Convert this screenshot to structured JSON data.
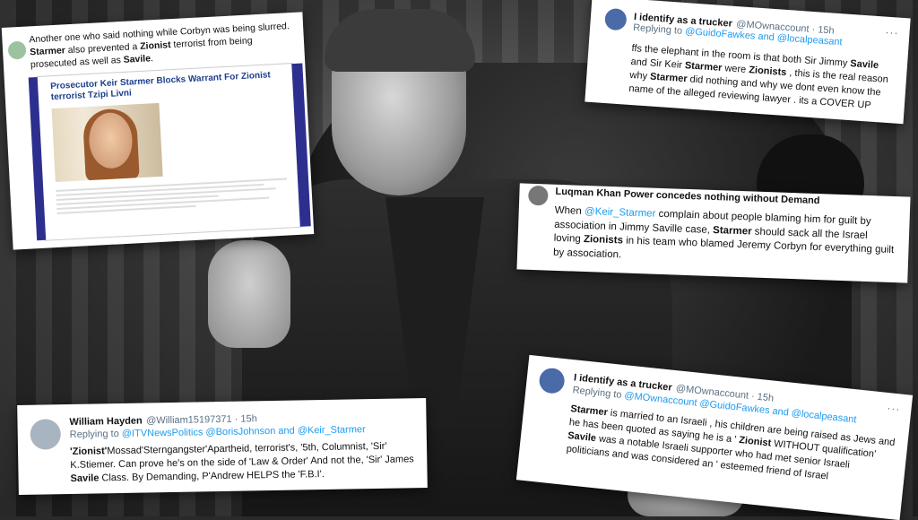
{
  "card1": {
    "tweet_text_1": "Another one who said nothing while Corbyn was being slurred. ",
    "tweet_bold_1": "Starmer",
    "tweet_text_2": " also prevented a ",
    "tweet_bold_2": "Zionist",
    "tweet_text_3": " terrorist from being prosecuted as well as ",
    "tweet_bold_3": "Savile",
    "tweet_text_4": ".",
    "article_headline": "Prosecutor Keir Starmer Blocks Warrant For Zionist terrorist Tzipi Livni"
  },
  "card2": {
    "name": "I identify as a trucker",
    "handle": "@MOwnaccount · 15h",
    "replying_prefix": "Replying to ",
    "replying_to": "@GuidoFawkes and @localpeasant",
    "body_1": "ffs the elephant in the room is that both Sir Jimmy ",
    "body_b1": "Savile",
    "body_2": " and Sir Keir ",
    "body_b2": "Starmer",
    "body_3": " were ",
    "body_b3": "Zionists",
    "body_4": " , this is the real reason why ",
    "body_b4": "Starmer",
    "body_5": " did nothing and why we dont even know the name of the alleged reviewing lawyer . its a COVER UP"
  },
  "card3": {
    "name": "Luqman Khan Power concedes nothing without Demand",
    "body_1": "When ",
    "body_link": "@Keir_Starmer",
    "body_2": " complain about people blaming him for guilt by association in Jimmy Saville case, ",
    "body_b1": "Starmer",
    "body_3": " should sack all the Israel loving ",
    "body_b2": "Zionists",
    "body_4": " in his team who blamed Jeremy Corbyn for everything guilt by association."
  },
  "card4": {
    "name": "William Hayden",
    "handle": "@William15197371 · 15h",
    "replying_prefix": "Replying to ",
    "replying_to": "@ITVNewsPolitics @BorisJohnson and @Keir_Starmer",
    "body_b1": "'Zionist'",
    "body_1": "Mossad'Sterngangster'Apartheid, terrorist's, '5th, Columnist, 'Sir' K.Stiemer. Can prove he's on the side of 'Law & Order' And not the, 'Sir' James ",
    "body_b2": "Savile",
    "body_2": " Class. By Demanding, P'Andrew HELPS the 'F.B.I'."
  },
  "card5": {
    "name": "I identify as a trucker",
    "handle": "@MOwnaccount · 15h",
    "replying_prefix": "Replying to ",
    "replying_to": "@MOwnaccount @GuidoFawkes and @localpeasant",
    "body_b1": "Starmer",
    "body_1": " is married to an Israeli , his children are being raised as Jews and he has been quoted as saying he is a ' ",
    "body_b2": "Zionist",
    "body_2": " WITHOUT qualification' ",
    "body_b3": "Savile",
    "body_3": " was a notable Israeli supporter who had met senior Israeli politicians and was considered an ' esteemed friend of Israel"
  },
  "more_icon": "···",
  "colors": {
    "link": "#1d9bf0",
    "article_bar": "#2d2f8f",
    "headline": "#1c3f8f"
  }
}
